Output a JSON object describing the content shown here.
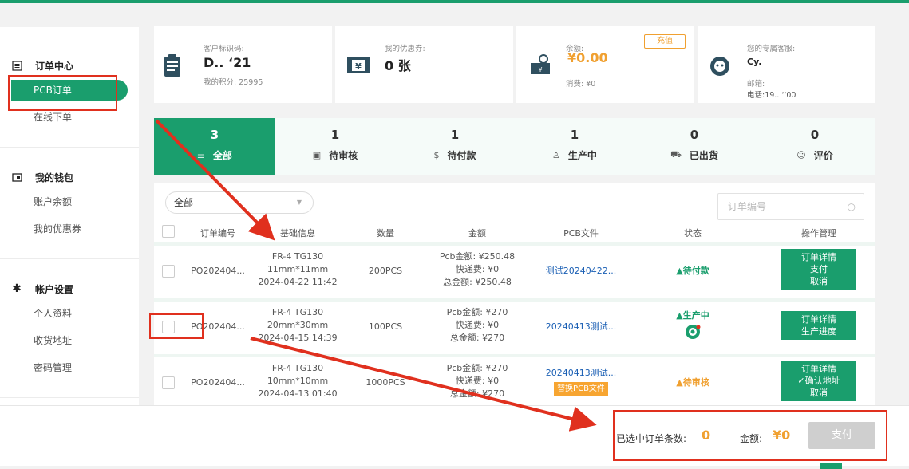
{
  "colors": {
    "accent": "#1a9e6d",
    "warn": "#f0a030",
    "annot": "#e0301e",
    "link": "#1a5fb4"
  },
  "sidebar": {
    "order_center": "订单中心",
    "pcb_orders": "PCB订单",
    "online_order": "在线下单",
    "wallet": "我的钱包",
    "balance": "账户余额",
    "coupons": "我的优惠券",
    "account": "帐户设置",
    "profile": "个人资料",
    "address": "收货地址",
    "password": "密码管理"
  },
  "cards": {
    "customer": {
      "label": "客户标识码:",
      "value": "D.. ‘21",
      "points": "我的积分: 25995"
    },
    "coupon": {
      "label": "我的优惠券:",
      "value": "0 张"
    },
    "balance": {
      "label": "余额:",
      "value": "¥0.00",
      "spent": "消费: ¥0",
      "recharge": "充值"
    },
    "service": {
      "label": "您的专属客服:",
      "name": "Cy.",
      "email": "邮箱:",
      "phone": "电话:19..   ‘‘00"
    }
  },
  "tabs": [
    {
      "count": "3",
      "label": "全部",
      "icon": "list-icon"
    },
    {
      "count": "1",
      "label": "待审核",
      "icon": "review-icon"
    },
    {
      "count": "1",
      "label": "待付款",
      "icon": "payment-icon"
    },
    {
      "count": "1",
      "label": "生产中",
      "icon": "production-icon"
    },
    {
      "count": "0",
      "label": "已出货",
      "icon": "shipped-icon"
    },
    {
      "count": "0",
      "label": "评价",
      "icon": "review-star-icon"
    }
  ],
  "filter": {
    "selected": "全部",
    "search_placeholder": "订单编号"
  },
  "columns": [
    "订单编号",
    "基础信息",
    "数量",
    "金额",
    "PCB文件",
    "状态",
    "操作管理"
  ],
  "rows": [
    {
      "order": "PO202404...",
      "info": [
        "FR-4 TG130",
        "11mm*11mm",
        "2024-04-22 11:42"
      ],
      "qty": "200PCS",
      "amount": [
        "Pcb金额: ¥250.48",
        "快递费: ¥0",
        "总金额: ¥250.48"
      ],
      "file": "测试20240422...",
      "status": "▲待付款",
      "ops": [
        "订单详情",
        "支付",
        "取消"
      ]
    },
    {
      "order": "PO202404...",
      "info": [
        "FR-4 TG130",
        "20mm*30mm",
        "2024-04-15 14:39"
      ],
      "qty": "100PCS",
      "amount": [
        "Pcb金额: ¥270",
        "快递费: ¥0",
        "总金额: ¥270"
      ],
      "file": "20240413测试...",
      "status": "▲生产中",
      "ops": [
        "订单详情",
        "生产进度"
      ]
    },
    {
      "order": "PO202404...",
      "info": [
        "FR-4 TG130",
        "10mm*10mm",
        "2024-04-13 01:40"
      ],
      "qty": "1000PCS",
      "amount": [
        "Pcb金额: ¥270",
        "快递费: ¥0",
        "总金额: ¥270"
      ],
      "file": "20240413测试...",
      "file_action": "替换PCB文件",
      "status": "▲待审核",
      "ops": [
        "订单详情",
        "✓确认地址",
        "取消"
      ]
    }
  ],
  "footer": {
    "selected_label": "已选中订单条数:",
    "selected_count": "0",
    "amount_label": "金额:",
    "amount_value": "¥0",
    "pay": "支付"
  }
}
